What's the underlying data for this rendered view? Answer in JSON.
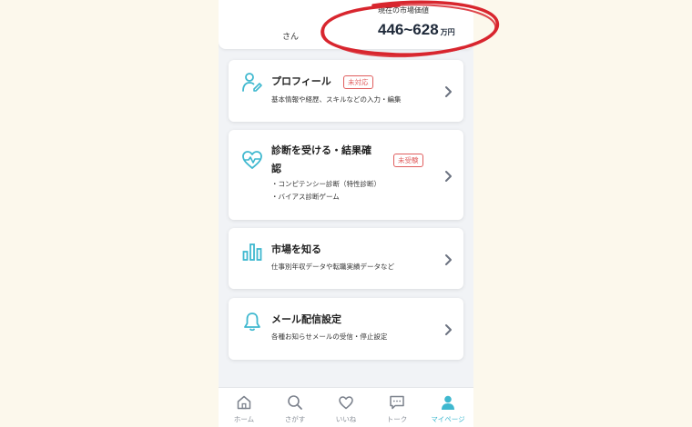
{
  "header": {
    "user_suffix": "さん",
    "market_label": "現在の市場価値",
    "market_value": "446~628",
    "market_unit": "万円"
  },
  "cards": [
    {
      "title": "プロフィール",
      "badge": "未対応",
      "desc": [
        "基本情報や経歴、スキルなどの入力・編集"
      ],
      "icon": "profile-edit-icon"
    },
    {
      "title_line1": "診断を受ける・結果確",
      "title_line2": "認",
      "badge": "未受験",
      "desc": [
        "・コンピテンシー診断（特性診断）",
        "・バイアス診断ゲーム"
      ],
      "icon": "heart-pulse-icon"
    },
    {
      "title": "市場を知る",
      "desc": [
        "仕事別年収データや転職実績データなど"
      ],
      "icon": "bar-chart-icon"
    },
    {
      "title": "メール配信設定",
      "desc": [
        "各種お知らせメールの受信・停止設定"
      ],
      "icon": "bell-icon"
    }
  ],
  "nav": [
    {
      "label": "ホーム",
      "icon": "home-icon"
    },
    {
      "label": "さがす",
      "icon": "search-icon"
    },
    {
      "label": "いいね",
      "icon": "heart-icon"
    },
    {
      "label": "トーク",
      "icon": "chat-icon"
    },
    {
      "label": "マイページ",
      "icon": "person-icon",
      "active": true
    }
  ],
  "colors": {
    "accent": "#3fb8cf",
    "badge": "#e05d5d",
    "highlight": "#d8262e",
    "background": "#fcf8ec"
  }
}
